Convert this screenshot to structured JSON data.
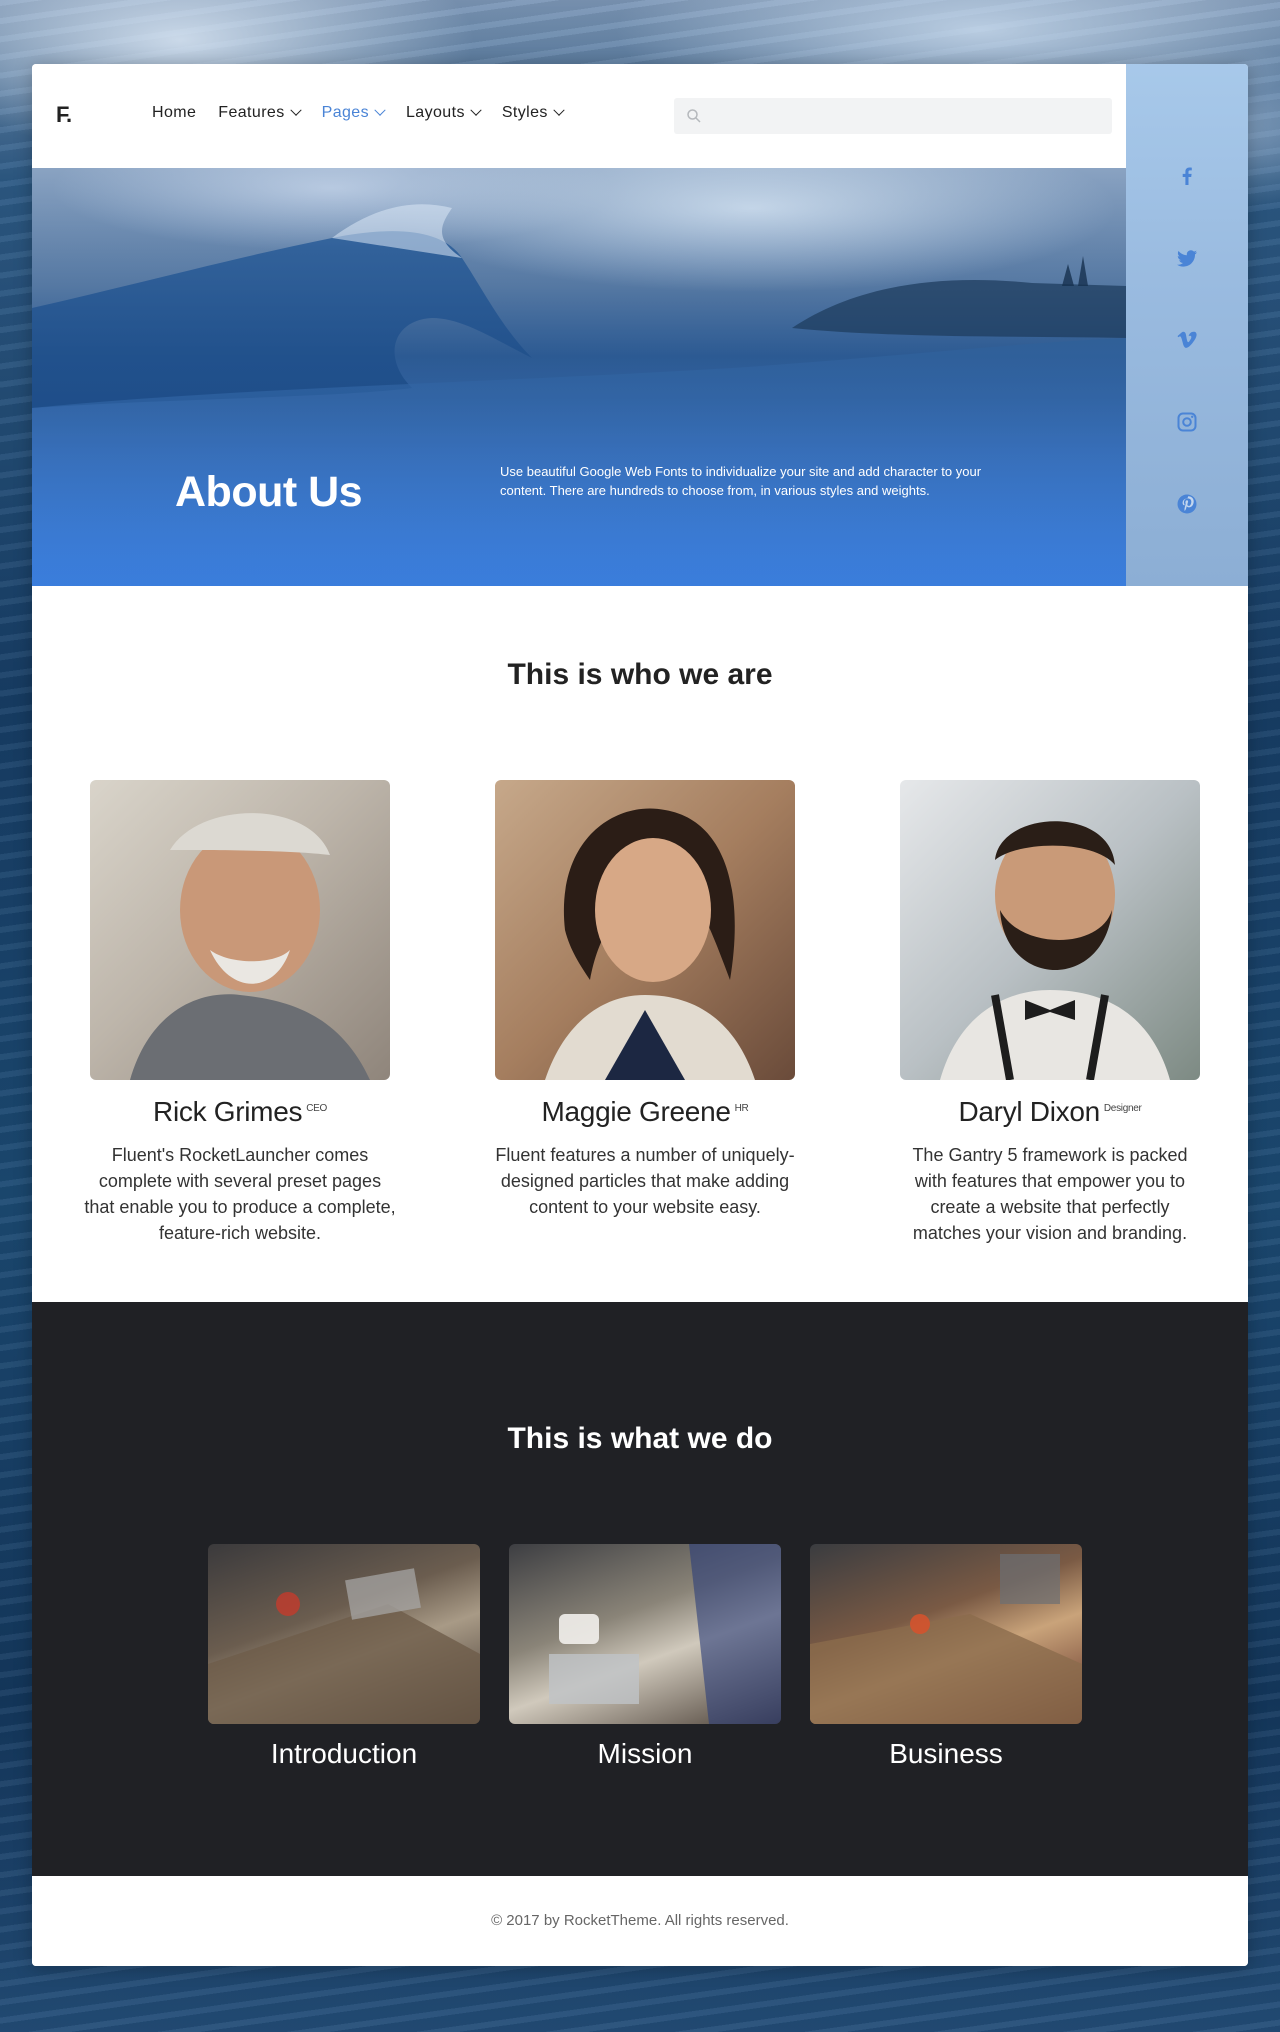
{
  "header": {
    "logo": "F.",
    "nav": [
      {
        "label": "Home",
        "has_dropdown": false,
        "active": false
      },
      {
        "label": "Features",
        "has_dropdown": true,
        "active": false
      },
      {
        "label": "Pages",
        "has_dropdown": true,
        "active": true
      },
      {
        "label": "Layouts",
        "has_dropdown": true,
        "active": false
      },
      {
        "label": "Styles",
        "has_dropdown": true,
        "active": false
      }
    ],
    "search": {
      "value": "",
      "placeholder": ""
    }
  },
  "social": [
    "facebook-icon",
    "twitter-icon",
    "vimeo-icon",
    "instagram-icon",
    "pinterest-icon"
  ],
  "colors": {
    "accent": "#4a84d6",
    "social_icon": "#4a84d6",
    "dark_section": "#202125"
  },
  "hero": {
    "title": "About Us",
    "text": "Use beautiful Google Web Fonts to individualize your site and add character to your content. There are hundreds to choose from, in various styles and weights."
  },
  "team": {
    "title": "This is who we are",
    "members": [
      {
        "name": "Rick Grimes",
        "role": "CEO",
        "description": "Fluent's RocketLauncher comes complete with several preset pages that enable you to produce a complete, feature-rich website."
      },
      {
        "name": "Maggie Greene",
        "role": "HR",
        "description": "Fluent features a number of uniquely-designed particles that make adding content to your website easy."
      },
      {
        "name": "Daryl Dixon",
        "role": "Designer",
        "description": "The Gantry 5 framework is packed with features that empower you to create a website that perfectly matches your vision and branding."
      }
    ]
  },
  "services": {
    "title": "This is what we do",
    "items": [
      {
        "label": "Introduction"
      },
      {
        "label": "Mission"
      },
      {
        "label": "Business"
      }
    ]
  },
  "footer": {
    "copyright": "© 2017 by RocketTheme. All rights reserved."
  }
}
